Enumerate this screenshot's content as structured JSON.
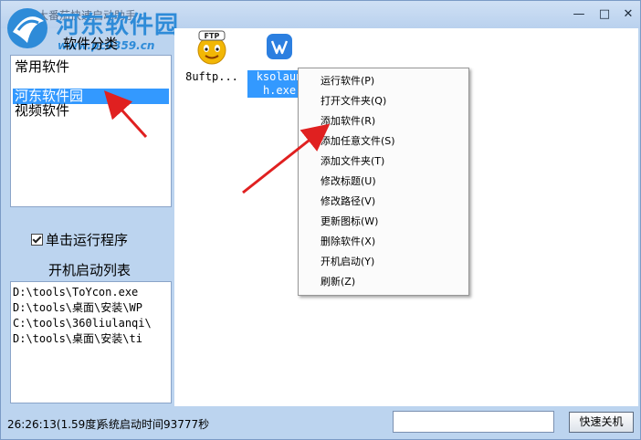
{
  "window": {
    "title": "大番茄快速启动助手",
    "minimize_icon": "minimize-icon",
    "maximize_icon": "maximize-icon",
    "close_icon": "close-icon"
  },
  "watermark": {
    "brand": "河东软件园",
    "url": "www.pc0359.cn"
  },
  "sidebar": {
    "category_title": "软件分类",
    "categories": [
      {
        "label": "常用软件"
      },
      {
        "label": "河东软件园",
        "selected": true
      },
      {
        "label": "视频软件"
      }
    ],
    "single_click_label": "单击运行程序",
    "single_click_checked": true,
    "startup_title": "开机启动列表",
    "startup_items": [
      "D:\\tools\\ToYcon.exe",
      "D:\\tools\\桌面\\安装\\WP",
      "C:\\tools\\360liulanqi\\",
      "D:\\tools\\桌面\\安装\\ti"
    ]
  },
  "apps": [
    {
      "label": "8uftp...",
      "icon": "ftp-icon"
    },
    {
      "label_line1": "ksolaun",
      "label_line2": "h.exe",
      "icon": "wps-icon",
      "selected": true
    }
  ],
  "context_menu": {
    "items": [
      {
        "label": "运行软件(P)"
      },
      {
        "label": "打开文件夹(Q)"
      },
      {
        "label": "添加软件(R)"
      },
      {
        "label": "添加任意文件(S)"
      },
      {
        "label": "添加文件夹(T)"
      },
      {
        "label": "修改标题(U)"
      },
      {
        "label": "修改路径(V)"
      },
      {
        "label": "更新图标(W)"
      },
      {
        "label": "删除软件(X)"
      },
      {
        "label": "开机启动(Y)"
      },
      {
        "label": "刷新(Z)"
      }
    ]
  },
  "status": {
    "time": "26:26:13(1.59度)",
    "info": "系统启动时间93777秒",
    "input_value": "",
    "shutdown_label": "快速关机"
  },
  "colors": {
    "accent": "#3399ff",
    "frame": "#bcd4ef",
    "arrow": "#e02020"
  }
}
